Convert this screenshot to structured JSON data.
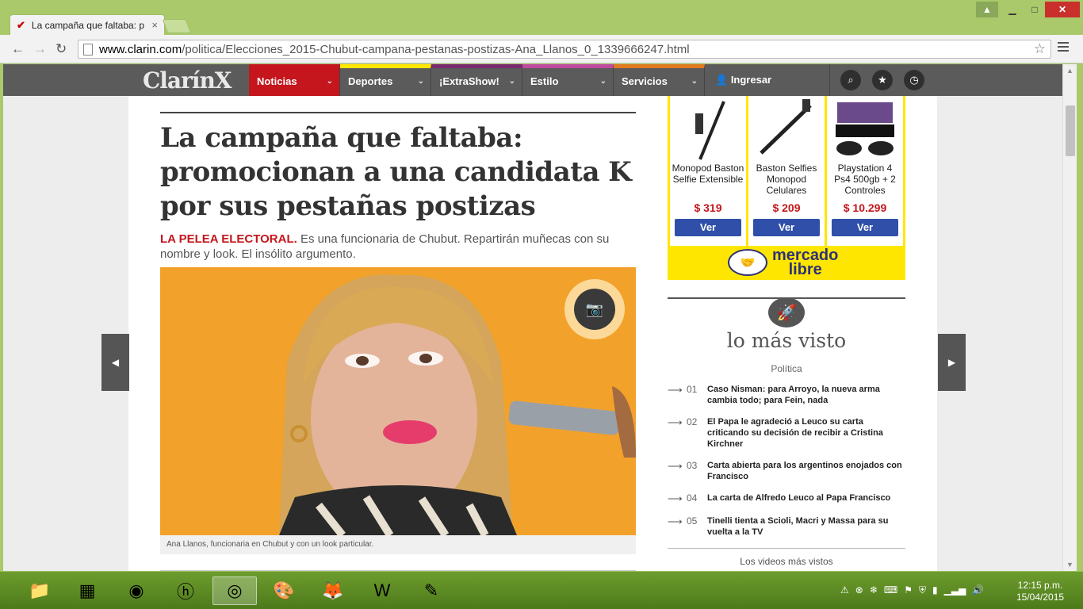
{
  "browser": {
    "tab_title": "La campaña que faltaba: p",
    "tab_close": "×",
    "url_domain": "www.clarin.com",
    "url_path": "/politica/Elecciones_2015-Chubut-campana-pestanas-postizas-Ana_Llanos_0_1339666247.html"
  },
  "site": {
    "logo": "ClarínX",
    "nav": [
      {
        "label": "Noticias",
        "color": "#c4161c",
        "accent": "#c4161c"
      },
      {
        "label": "Deportes",
        "color": "#5b5b5b",
        "accent": "#ffe600"
      },
      {
        "label": "¡ExtraShow!",
        "color": "#5b5b5b",
        "accent": "#7a2a6e"
      },
      {
        "label": "Estilo",
        "color": "#5b5b5b",
        "accent": "#c04aa0"
      },
      {
        "label": "Servicios",
        "color": "#5b5b5b",
        "accent": "#e07a1f"
      }
    ],
    "login": "Ingresar"
  },
  "article": {
    "headline": "La campaña que faltaba: promocionan a una candidata K por sus pestañas postizas",
    "kicker": "LA PELEA ELECTORAL.",
    "lead": " Es una funcionaria de Chubut. Repartirán muñecas con su nombre y look. El insólito argumento.",
    "caption": "Ana Llanos, funcionaria en Chubut y con un look particular."
  },
  "ad": {
    "products": [
      {
        "name": "Monopod Baston Selfie Extensible",
        "price": "$ 319",
        "button": "Ver"
      },
      {
        "name": "Baston Selfies Monopod Celulares",
        "price": "$ 209",
        "button": "Ver"
      },
      {
        "name": "Playstation 4 Ps4 500gb + 2 Controles",
        "price": "$ 10.299",
        "button": "Ver"
      }
    ],
    "brand_line1": "mercado",
    "brand_line2": "libre"
  },
  "most_viewed": {
    "title": "lo más visto",
    "section": "Política",
    "items": [
      {
        "num": "01",
        "text": "Caso Nisman: para Arroyo, la nueva arma cambia todo; para Fein, nada"
      },
      {
        "num": "02",
        "text": "El Papa le agradeció a Leuco su carta criticando su decisión de recibir a Cristina Kirchner"
      },
      {
        "num": "03",
        "text": "Carta abierta para los argentinos enojados con Francisco"
      },
      {
        "num": "04",
        "text": "La carta de Alfredo Leuco al Papa Francisco"
      },
      {
        "num": "05",
        "text": "Tinelli tienta a Scioli, Macri y Massa para su vuelta a la TV"
      }
    ],
    "videos": "Los videos más vistos"
  },
  "taskbar": {
    "time": "12:15 p.m.",
    "date": "15/04/2015"
  }
}
